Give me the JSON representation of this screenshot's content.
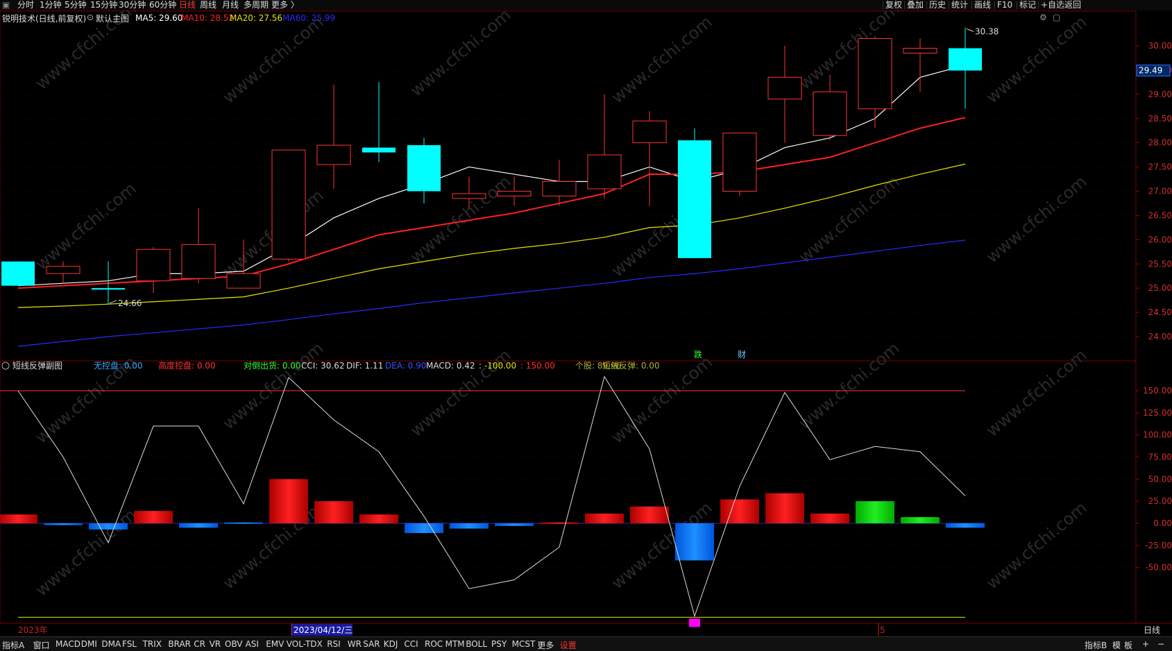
{
  "toolbar": {
    "periods": [
      "分时",
      "1分钟",
      "5分钟",
      "15分钟",
      "30分钟",
      "60分钟",
      "日线",
      "周线",
      "月线",
      "多周期",
      "更多 〉"
    ],
    "active_period": "日线",
    "right_buttons": [
      "复权",
      "叠加",
      "历史",
      "统计",
      "画线",
      "F10",
      "标记",
      "+自选",
      "返回"
    ]
  },
  "main_panel": {
    "stock_title": "锐明技术(日线,前复权)",
    "template_label": "默认主图",
    "ma_labels": [
      {
        "text": "MA5: 29.60",
        "color": "#ffffff"
      },
      {
        "text": "MA10: 28.52",
        "color": "#ff2020"
      },
      {
        "text": "MA20: 27.56",
        "color": "#e6e600"
      },
      {
        "text": "MA60: 25.99",
        "color": "#2a2aff"
      }
    ],
    "high_label": "30.38",
    "low_label": "24.66",
    "current_price_tag": "29.49",
    "event_labels": [
      {
        "text": "跌",
        "color": "#33ff33"
      },
      {
        "text": "财",
        "color": "#66ccff"
      }
    ],
    "y_axis_ticks": [
      "30.00",
      "29.50",
      "29.00",
      "28.50",
      "28.00",
      "27.50",
      "27.00",
      "26.50",
      "26.00",
      "25.50",
      "25.00",
      "24.50",
      "24.00"
    ]
  },
  "sub_panel": {
    "title": "短线反弹副图",
    "indicators": [
      {
        "text": "无控盘: 0.00",
        "color": "#33aaff"
      },
      {
        "text": "高度控盘: 0.00",
        "color": "#ff3333"
      },
      {
        "text": "对倒出货: 0.00",
        "color": "#33ff33"
      },
      {
        "text": "CCI: 30.62",
        "color": "#dddddd"
      },
      {
        "text": "DIF: 1.11",
        "color": "#dddddd"
      },
      {
        "text": "DEA: 0.90",
        "color": "#3355ff"
      },
      {
        "text": "MACD: 0.42",
        "color": "#dddddd"
      },
      {
        "text": ": -100.00",
        "color": "#e6e600"
      },
      {
        "text": ": 150.00",
        "color": "#ff3333"
      },
      {
        "text": "个股: 89.96",
        "color": "#b0b030"
      },
      {
        "text": "短线反弹: 0.00",
        "color": "#b0b030"
      }
    ],
    "y_axis_ticks": [
      "150.00",
      "125.00",
      "100.00",
      "75.00",
      "50.00",
      "25.00",
      "0.00",
      "-25.00",
      "-50.00"
    ]
  },
  "date_axis": {
    "labels": [
      "2023年",
      "2023/04/12/三",
      "5"
    ],
    "right_label": "日线"
  },
  "bottom_tabs": {
    "left": [
      "指标A",
      "窗口",
      "MACD",
      "DMI",
      "DMA",
      "FSL",
      "TRIX",
      "BRAR",
      "CR",
      "VR",
      "OBV",
      "ASI",
      "EMV",
      "VOL-TDX",
      "RSI",
      "WR",
      "SAR",
      "KDJ",
      "CCI",
      "ROC",
      "MTM",
      "BOLL",
      "PSY",
      "MCST",
      "更多",
      "设置"
    ],
    "right": [
      "指标B",
      "模",
      "板",
      "+",
      "−"
    ]
  },
  "watermark": "www.cfchi.com",
  "chart_data": [
    {
      "type": "candlestick",
      "candles": [
        {
          "o": 25.55,
          "h": 25.55,
          "l": 25.05,
          "c": 25.05
        },
        {
          "o": 25.3,
          "h": 25.55,
          "l": 25.1,
          "c": 25.45
        },
        {
          "o": 25.0,
          "h": 25.55,
          "l": 24.66,
          "c": 24.97
        },
        {
          "o": 25.15,
          "h": 25.85,
          "l": 24.9,
          "c": 25.8
        },
        {
          "o": 25.2,
          "h": 26.65,
          "l": 25.1,
          "c": 25.9
        },
        {
          "o": 25.0,
          "h": 26.0,
          "l": 25.0,
          "c": 25.3
        },
        {
          "o": 25.6,
          "h": 27.85,
          "l": 25.55,
          "c": 27.85
        },
        {
          "o": 27.55,
          "h": 29.2,
          "l": 27.05,
          "c": 27.95
        },
        {
          "o": 27.9,
          "h": 29.25,
          "l": 27.6,
          "c": 27.8
        },
        {
          "o": 27.95,
          "h": 28.1,
          "l": 26.75,
          "c": 27.0
        },
        {
          "o": 26.85,
          "h": 27.3,
          "l": 26.65,
          "c": 26.95
        },
        {
          "o": 26.9,
          "h": 27.3,
          "l": 26.7,
          "c": 27.0
        },
        {
          "o": 26.9,
          "h": 27.65,
          "l": 26.7,
          "c": 27.2
        },
        {
          "o": 27.05,
          "h": 29.0,
          "l": 26.85,
          "c": 27.75
        },
        {
          "o": 28.0,
          "h": 28.65,
          "l": 26.7,
          "c": 28.45
        },
        {
          "o": 28.05,
          "h": 28.3,
          "l": 25.62,
          "c": 25.62
        },
        {
          "o": 27.0,
          "h": 28.2,
          "l": 26.9,
          "c": 28.2
        },
        {
          "o": 28.9,
          "h": 30.0,
          "l": 28.0,
          "c": 29.35
        },
        {
          "o": 28.15,
          "h": 29.4,
          "l": 28.05,
          "c": 29.05
        },
        {
          "o": 28.7,
          "h": 30.2,
          "l": 28.3,
          "c": 30.15
        },
        {
          "o": 29.85,
          "h": 30.15,
          "l": 29.05,
          "c": 29.95
        },
        {
          "o": 29.95,
          "h": 30.38,
          "l": 28.7,
          "c": 29.49
        }
      ],
      "ma": [
        {
          "name": "MA5",
          "color": "#ffffff",
          "values": [
            25.05,
            25.1,
            25.15,
            25.3,
            25.3,
            25.35,
            25.85,
            26.45,
            26.85,
            27.15,
            27.5,
            27.35,
            27.2,
            27.2,
            27.5,
            27.2,
            27.45,
            27.9,
            28.1,
            28.5,
            29.35,
            29.6
          ]
        },
        {
          "name": "MA10",
          "color": "#ff2020",
          "values": [
            25.0,
            25.05,
            25.1,
            25.15,
            25.2,
            25.25,
            25.5,
            25.8,
            26.1,
            26.25,
            26.4,
            26.55,
            26.75,
            26.95,
            27.35,
            27.35,
            27.4,
            27.55,
            27.7,
            28.0,
            28.3,
            28.52
          ]
        },
        {
          "name": "MA20",
          "color": "#e6e600",
          "values": [
            24.6,
            24.63,
            24.67,
            24.72,
            24.77,
            24.82,
            25.0,
            25.2,
            25.4,
            25.55,
            25.7,
            25.82,
            25.92,
            26.05,
            26.25,
            26.3,
            26.45,
            26.65,
            26.87,
            27.12,
            27.35,
            27.56
          ]
        },
        {
          "name": "MA60",
          "color": "#2a2aff",
          "values": [
            23.8,
            23.9,
            24.0,
            24.08,
            24.16,
            24.24,
            24.35,
            24.47,
            24.58,
            24.7,
            24.8,
            24.9,
            25.0,
            25.1,
            25.22,
            25.3,
            25.4,
            25.52,
            25.64,
            25.76,
            25.88,
            25.99
          ]
        }
      ],
      "ylim": [
        23.9,
        30.4
      ]
    },
    {
      "type": "bar+line",
      "histogram": [
        {
          "v": 10,
          "color": "red"
        },
        {
          "v": -2,
          "color": "blue"
        },
        {
          "v": -7,
          "color": "blue"
        },
        {
          "v": 14,
          "color": "red"
        },
        {
          "v": -5,
          "color": "blue"
        },
        {
          "v": 1,
          "color": "blue"
        },
        {
          "v": 50,
          "color": "red"
        },
        {
          "v": 25,
          "color": "red"
        },
        {
          "v": 10,
          "color": "red"
        },
        {
          "v": -11,
          "color": "blue"
        },
        {
          "v": -6,
          "color": "blue"
        },
        {
          "v": -3,
          "color": "blue"
        },
        {
          "v": 1,
          "color": "red"
        },
        {
          "v": 11,
          "color": "red"
        },
        {
          "v": 19,
          "color": "red"
        },
        {
          "v": -42,
          "color": "blue"
        },
        {
          "v": 27,
          "color": "red"
        },
        {
          "v": 34,
          "color": "red"
        },
        {
          "v": 11,
          "color": "red"
        },
        {
          "v": 25,
          "color": "green"
        },
        {
          "v": 7,
          "color": "green"
        },
        {
          "v": -5,
          "color": "blue"
        }
      ],
      "cci": [
        150,
        75,
        -22,
        110,
        110,
        22,
        165,
        117,
        81,
        8,
        -74,
        -64,
        -27,
        166,
        84,
        -105,
        42,
        148,
        72,
        87,
        81,
        31
      ],
      "upper_line": 150,
      "lower_line": -100,
      "marker": {
        "index": 15,
        "value": -105,
        "color": "#ff00ff"
      },
      "ylim": [
        -110,
        170
      ]
    }
  ]
}
